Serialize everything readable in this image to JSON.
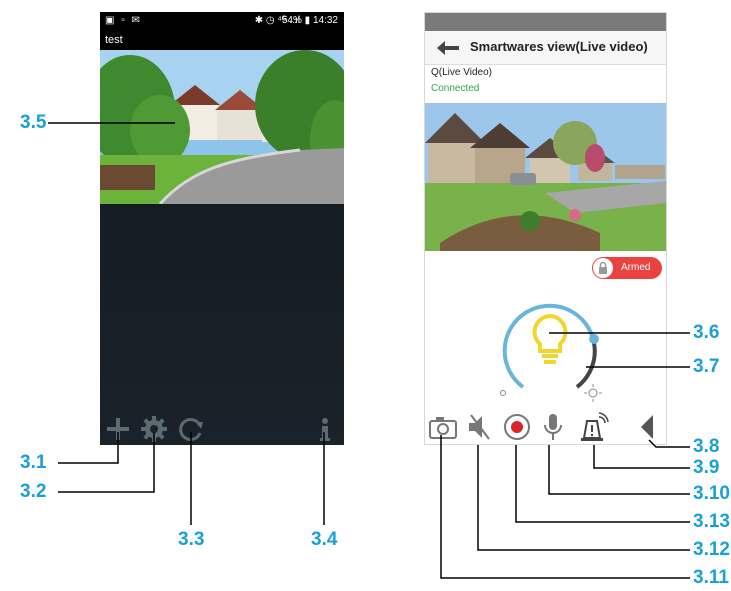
{
  "left_phone": {
    "status_bar": {
      "time": "14:32",
      "battery": "54%"
    },
    "camera_title": "test",
    "toolbar": {
      "add_icon": "plus-icon",
      "settings_icon": "gear-icon",
      "refresh_icon": "refresh-icon",
      "info_icon": "info-icon"
    }
  },
  "right_phone": {
    "header": {
      "title": "Smartwares view(Live video)",
      "back_icon": "back-arrow-icon"
    },
    "camera_name": "Q(Live Video)",
    "connection_status": "Connected",
    "armed_toggle": {
      "label": "Armed",
      "icon": "lock-icon"
    },
    "light": {
      "icon": "light-bulb-icon"
    },
    "toolbar": {
      "snapshot_icon": "camera-icon",
      "mute_icon": "speaker-mute-icon",
      "record_icon": "record-icon",
      "mic_icon": "microphone-icon",
      "siren_icon": "siren-icon",
      "collapse_icon": "triangle-left-icon"
    }
  },
  "callouts": {
    "c3_1": "3.1",
    "c3_2": "3.2",
    "c3_3": "3.3",
    "c3_4": "3.4",
    "c3_5": "3.5",
    "c3_6": "3.6",
    "c3_7": "3.7",
    "c3_8": "3.8",
    "c3_9": "3.9",
    "c3_10": "3.10",
    "c3_11": "3.11",
    "c3_12": "3.12",
    "c3_13": "3.13"
  },
  "colors": {
    "callout": "#1aa0d8",
    "connected": "#2ea84a",
    "armed": "#e9423f",
    "bulb": "#f4d431",
    "dial": "#6ab5dc"
  }
}
